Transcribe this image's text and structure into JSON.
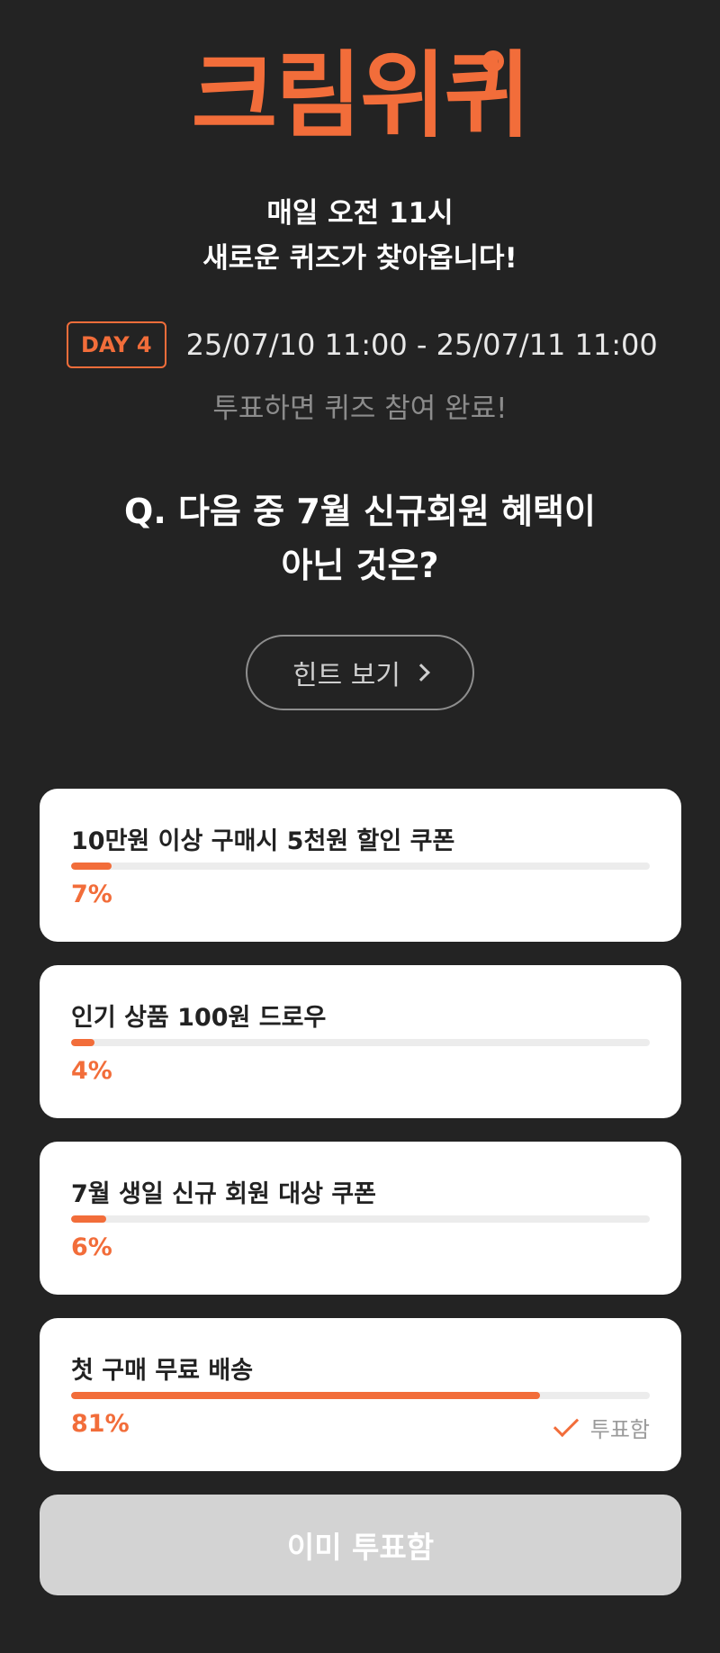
{
  "brand": {
    "logo_text": "크림위퀴"
  },
  "intro": {
    "line1": "매일 오전 11시",
    "line2": "새로운 퀴즈가 찾아옵니다!"
  },
  "schedule": {
    "day_badge": "DAY 4",
    "date_range": "25/07/10 11:00 - 25/07/11 11:00",
    "vote_note": "투표하면 퀴즈 참여 완료!"
  },
  "question": {
    "line1": "Q. 다음 중 7월 신규회원 혜택이",
    "line2": "아닌 것은?"
  },
  "hint": {
    "label": "힌트 보기",
    "icon": "chevron-right-icon"
  },
  "options": [
    {
      "label": "10만원 이상 구매시 5천원 할인 쿠폰",
      "percent": 7,
      "percent_text": "7%",
      "voted": false
    },
    {
      "label": "인기 상품 100원 드로우",
      "percent": 4,
      "percent_text": "4%",
      "voted": false
    },
    {
      "label": "7월 생일 신규 회원 대상 쿠폰",
      "percent": 6,
      "percent_text": "6%",
      "voted": false
    },
    {
      "label": "첫 구매 무료 배송",
      "percent": 81,
      "percent_text": "81%",
      "voted": true,
      "voted_label": "투표함"
    }
  ],
  "footer": {
    "button_label": "이미 투표함"
  },
  "colors": {
    "background": "#232323",
    "accent": "#f26d3a",
    "card": "#ffffff",
    "disabled_button": "#d3d3d3"
  }
}
